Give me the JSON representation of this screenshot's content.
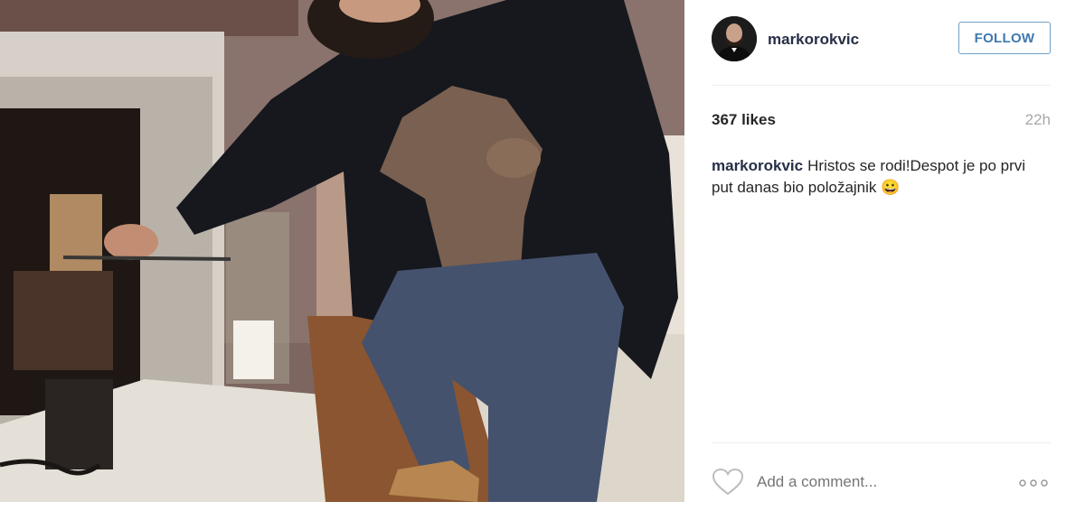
{
  "post": {
    "photo_icon": "post-photo",
    "user": {
      "username": "markorokvic",
      "avatar_icon": "avatar-photo"
    },
    "follow_label": "FOLLOW",
    "likes": "367 likes",
    "time": "22h",
    "caption": {
      "username": "markorokvic",
      "text": "Hristos se rodi!Despot je po prvi put danas bio položajnik",
      "emoji": "😀"
    },
    "actions": {
      "like_icon": "heart-icon",
      "comment_placeholder": "Add a comment...",
      "more_icon": "more-options-icon"
    }
  },
  "colors": {
    "follow_border": "#70a0c8",
    "follow_text": "#3f78b0",
    "username": "#262f47",
    "muted": "#a8a8a8"
  }
}
